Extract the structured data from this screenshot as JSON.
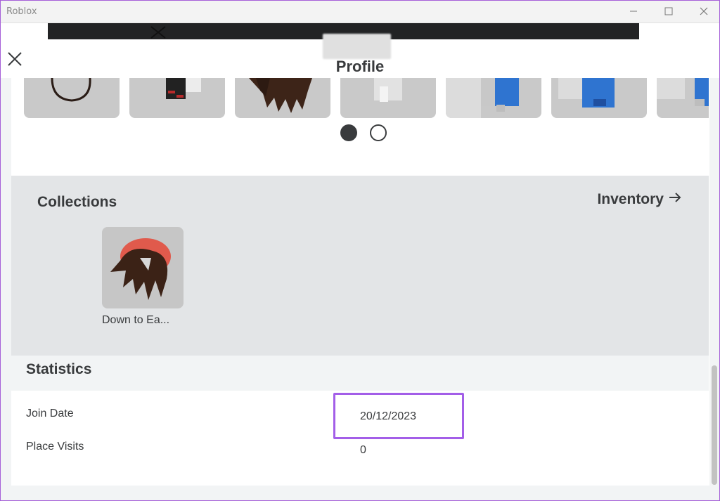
{
  "window": {
    "app_title": "Roblox",
    "controls": {
      "minimize_icon": "minimize-icon",
      "maximize_icon": "maximize-icon",
      "close_icon": "close-icon"
    }
  },
  "header": {
    "title": "Profile",
    "close_icon": "close-icon"
  },
  "carousel": {
    "items": [
      {
        "name": "necklace-item"
      },
      {
        "name": "shirt-item"
      },
      {
        "name": "hair-item"
      },
      {
        "name": "pants-item"
      },
      {
        "name": "blue-arm-item"
      },
      {
        "name": "blue-arm-item-2"
      },
      {
        "name": "blue-arm-item-3"
      }
    ],
    "pages": 2,
    "current_page": 1
  },
  "collections": {
    "title": "Collections",
    "inventory_label": "Inventory",
    "inventory_icon": "arrow-right-icon",
    "items": [
      {
        "name": "Down to Ea..."
      }
    ]
  },
  "statistics": {
    "title": "Statistics",
    "rows": [
      {
        "label": "Join Date",
        "value": "20/12/2023"
      },
      {
        "label": "Place Visits",
        "value": "0"
      }
    ]
  },
  "colors": {
    "highlight": "#a35ee8",
    "panel": "#e3e5e7",
    "text": "#393b3d"
  }
}
